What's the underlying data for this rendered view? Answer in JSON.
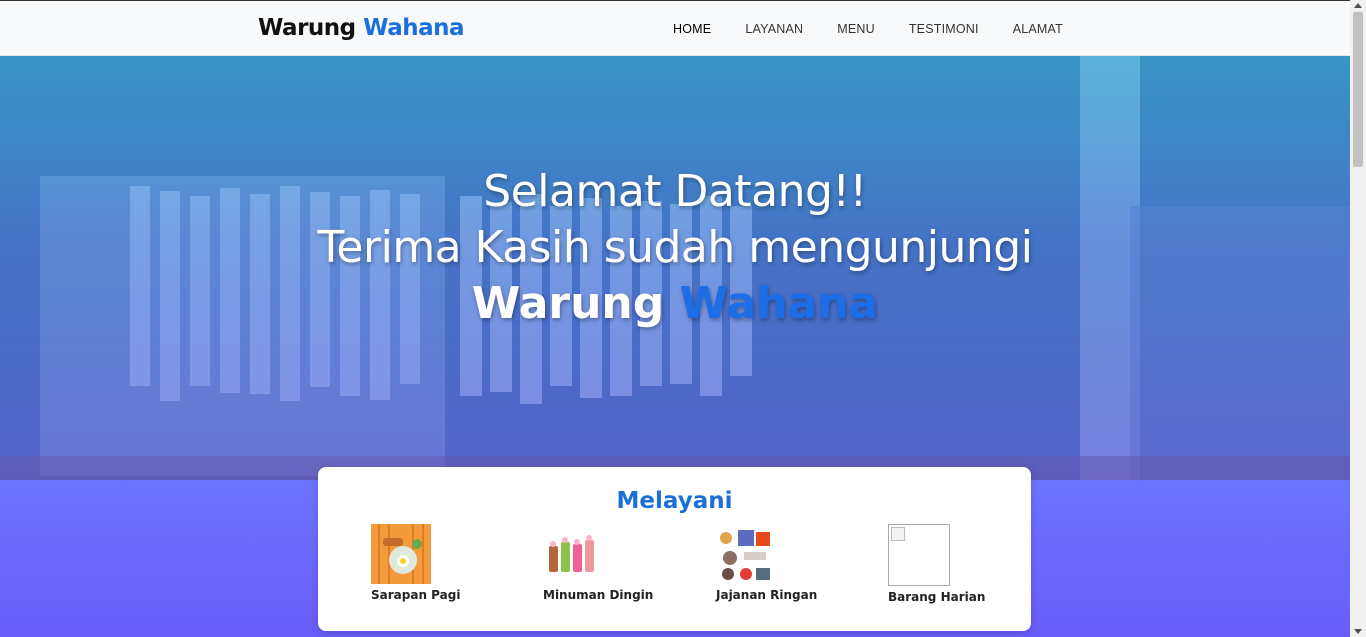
{
  "navbar": {
    "brand_part1": "Warung",
    "brand_part2": "Wahana",
    "links": [
      "HOME",
      "LAYANAN",
      "MENU",
      "TESTIMONI",
      "ALAMAT"
    ]
  },
  "hero": {
    "line1": "Selamat Datang!!",
    "line2": "Terima Kasih sudah mengunjungi",
    "brand_part1": "Warung",
    "brand_part2": "Wahana"
  },
  "services": {
    "title": "Melayani",
    "items": [
      {
        "label": "Sarapan Pagi",
        "icon": "breakfast-icon"
      },
      {
        "label": "Minuman Dingin",
        "icon": "cold-drinks-icon"
      },
      {
        "label": "Jajanan Ringan",
        "icon": "snacks-icon"
      },
      {
        "label": "Barang Harian",
        "icon": "broken-image-icon"
      }
    ]
  },
  "colors": {
    "accent": "#1a6fd8",
    "hero_top": "#14bef0",
    "hero_bottom": "#5050fa",
    "band": "#6b74ff"
  }
}
